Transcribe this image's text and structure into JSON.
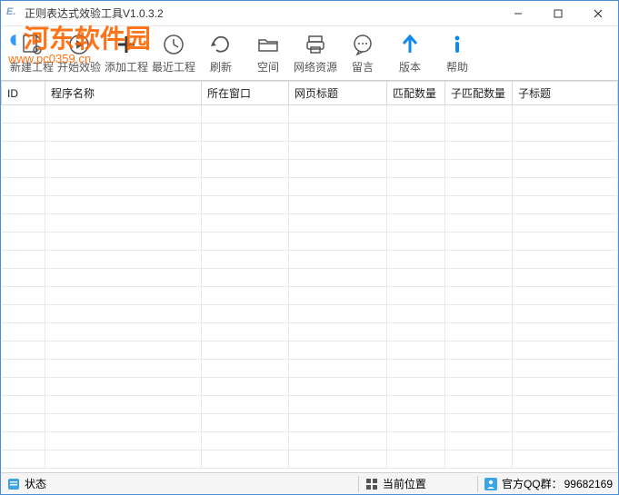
{
  "window": {
    "title": "正则表达式效验工具V1.0.3.2"
  },
  "toolbar": {
    "items": [
      {
        "label": "新建工程",
        "icon": "new"
      },
      {
        "label": "开始效验",
        "icon": "play"
      },
      {
        "label": "添加工程",
        "icon": "add"
      },
      {
        "label": "最近工程",
        "icon": "recent"
      },
      {
        "label": "刷新",
        "icon": "refresh"
      },
      {
        "label": "空间",
        "icon": "folder"
      },
      {
        "label": "网络资源",
        "icon": "print"
      },
      {
        "label": "留言",
        "icon": "chat"
      },
      {
        "label": "版本",
        "icon": "up"
      },
      {
        "label": "帮助",
        "icon": "info"
      }
    ]
  },
  "table": {
    "columns": [
      "ID",
      "程序名称",
      "所在窗口",
      "网页标题",
      "匹配数量",
      "子匹配数量",
      "子标题"
    ],
    "rows": []
  },
  "statusbar": {
    "status_label": "状态",
    "position_label": "当前位置",
    "qq_label": "官方QQ群：",
    "qq_number": "99682169"
  },
  "watermark": {
    "text": "河东软件园",
    "url": "www.pc0359.cn"
  }
}
